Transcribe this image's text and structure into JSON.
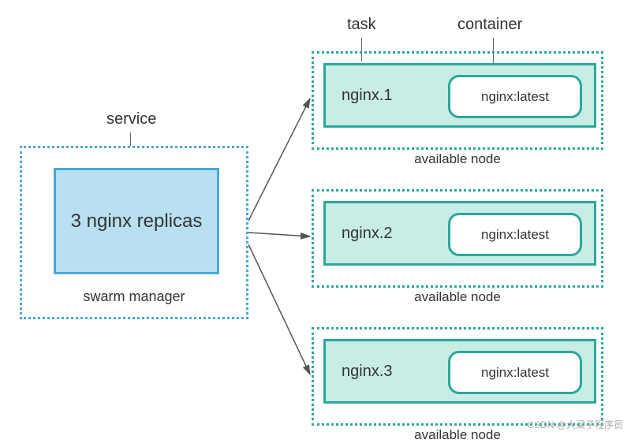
{
  "labels": {
    "service": "service",
    "task": "task",
    "container": "container",
    "swarm_manager": "swarm manager",
    "available_node": "available node"
  },
  "service": {
    "text": "3 nginx replicas"
  },
  "tasks": [
    {
      "name": "nginx.1",
      "image": "nginx:latest"
    },
    {
      "name": "nginx.2",
      "image": "nginx:latest"
    },
    {
      "name": "nginx.3",
      "image": "nginx:latest"
    }
  ],
  "watermark": "CSDN @大梁子程序员"
}
